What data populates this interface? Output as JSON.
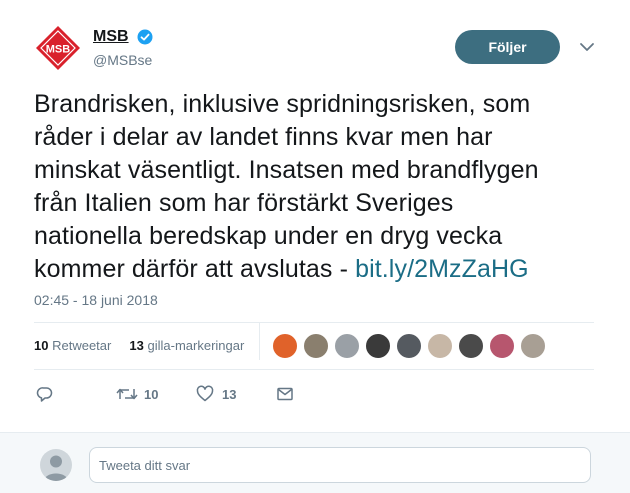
{
  "author": {
    "name": "MSB",
    "handle": "@MSBse",
    "logo_text": "MSB",
    "brand_color": "#d9212c",
    "verified": true
  },
  "follow_button": {
    "label": "Följer"
  },
  "tweet": {
    "lines": [
      "Brandrisken, inklusive spridningsrisken, som",
      "råder i delar av landet finns kvar men har",
      "minskat väsentligt. Insatsen med brandflygen",
      "från Italien som har förstärkt Sveriges",
      "nationella beredskap under en dryg vecka",
      "kommer därför att avslutas - "
    ],
    "link": "bit.ly/2MzZaHG",
    "timestamp": "02:45 - 18 juni 2018"
  },
  "stats": {
    "retweets": {
      "count": "10",
      "label": "Retweetar"
    },
    "likes": {
      "count": "13",
      "label": "gilla-markeringar"
    }
  },
  "liker_avatars": [
    {
      "color": "#e0622a"
    },
    {
      "color": "#8a7f6e"
    },
    {
      "color": "#9aa0a6"
    },
    {
      "color": "#3a3a3a"
    },
    {
      "color": "#555a60"
    },
    {
      "color": "#c7b7a6"
    },
    {
      "color": "#4a4a4a"
    },
    {
      "color": "#b7566e"
    },
    {
      "color": "#a89f94"
    }
  ],
  "actions": {
    "reply_icon": "reply-icon",
    "retweet_count": "10",
    "like_count": "13",
    "dm_icon": "envelope-icon"
  },
  "reply": {
    "placeholder": "Tweeta ditt svar"
  },
  "colors": {
    "follow_bg": "#3d6e80",
    "link": "#1b6d86",
    "muted": "#657786",
    "verified": "#1da1f2"
  }
}
